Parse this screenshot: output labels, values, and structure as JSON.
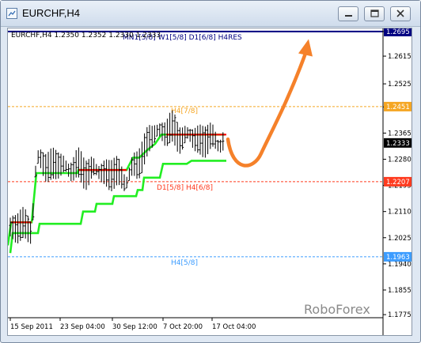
{
  "window": {
    "title": "EURCHF,H4",
    "controls": [
      "minimize",
      "restore",
      "close"
    ]
  },
  "chart_data": {
    "type": "bar",
    "info_line": "EURCHF,H4  1.2350 1.2352 1.2330 1.2333",
    "symbol": "EURCHF",
    "timeframe": "H4",
    "ohlc": {
      "open": 1.235,
      "high": 1.2352,
      "low": 1.233,
      "close": 1.2333
    },
    "ylim": [
      1.1765,
      1.2705
    ],
    "y_ticks": [
      "1.2695",
      "1.2615",
      "1.2525",
      "1.2450",
      "1.2365",
      "1.2280",
      "1.2195",
      "1.2110",
      "1.2025",
      "1.1940",
      "1.1855",
      "1.1775"
    ],
    "x_ticks": [
      "15 Sep 2011",
      "23 Sep 04:00",
      "30 Sep 12:00",
      "7 Oct 20:00",
      "17 Oct 04:00"
    ],
    "levels": [
      {
        "label": "MN1[5/8] W1[5/8] D1[6/8] H4RES",
        "value": 1.2695,
        "tag": "1.2695",
        "color": "#000080",
        "style": "solid"
      },
      {
        "label": "H4[7/8]",
        "value": 1.2451,
        "tag": "1.2451",
        "color": "#f5a623",
        "style": "dashed"
      },
      {
        "label": "D1[5/8] H4[6/8]",
        "value": 1.2207,
        "tag": "1.2207",
        "color": "#ff3b1f",
        "style": "dashed"
      },
      {
        "label": "H4[5/8]",
        "value": 1.1963,
        "tag": "1.1963",
        "color": "#3c9cff",
        "style": "dashed"
      }
    ],
    "current_price_tag": "1.2333",
    "watermark": "RoboForex",
    "colors": {
      "background": "#ffffff",
      "bars": "#000000",
      "indicator": "#22ee22",
      "red_segment": "#ff0000",
      "forecast_arrow": "#f5812a",
      "price_tag_bg": "#000000"
    }
  }
}
